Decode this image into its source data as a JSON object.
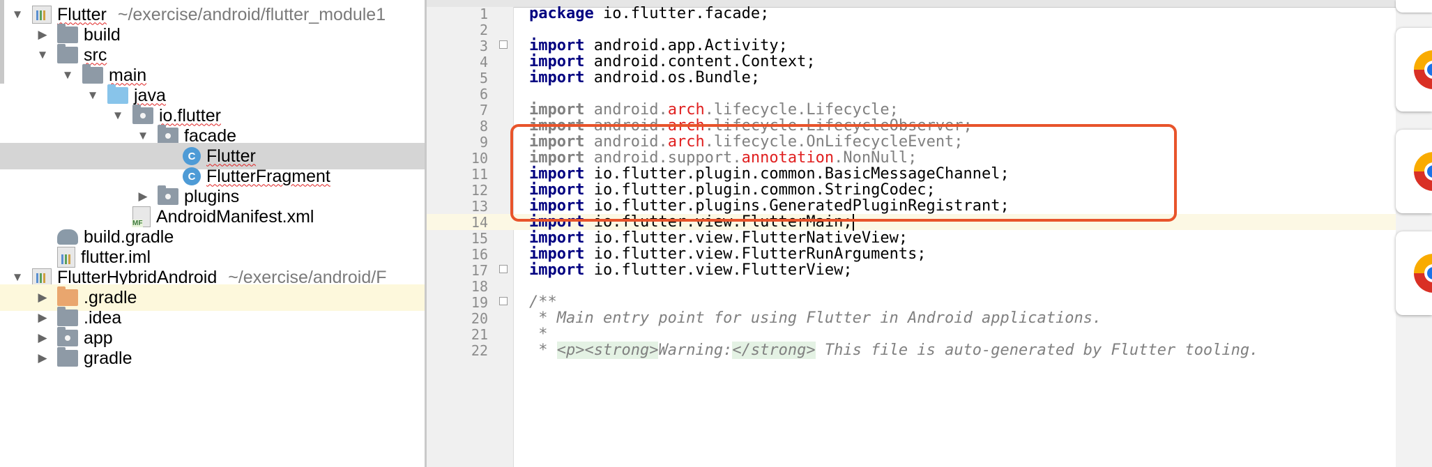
{
  "project_tree": {
    "rows": [
      {
        "label": "Flutter",
        "path": "~/exercise/android/flutter_module1",
        "arrow": "▼",
        "icon": "module-icon"
      },
      {
        "label": "build",
        "arrow": "▶",
        "icon": "folder-icon"
      },
      {
        "label": "src",
        "arrow": "▼",
        "icon": "folder-icon"
      },
      {
        "label": "main",
        "arrow": "▼",
        "icon": "folder-icon"
      },
      {
        "label": "java",
        "arrow": "▼",
        "icon": "source-folder-icon"
      },
      {
        "label": "io.flutter",
        "arrow": "▼",
        "icon": "package-icon"
      },
      {
        "label": "facade",
        "arrow": "▼",
        "icon": "package-icon"
      },
      {
        "label": "Flutter",
        "arrow": "",
        "icon": "class-icon",
        "icon_letter": "C"
      },
      {
        "label": "FlutterFragment",
        "arrow": "",
        "icon": "class-icon",
        "icon_letter": "C"
      },
      {
        "label": "plugins",
        "arrow": "▶",
        "icon": "package-icon"
      },
      {
        "label": "AndroidManifest.xml",
        "arrow": "",
        "icon": "manifest-icon",
        "icon_tag": "MF"
      },
      {
        "label": "build.gradle",
        "arrow": "",
        "icon": "gradle-icon"
      },
      {
        "label": "flutter.iml",
        "arrow": "",
        "icon": "iml-icon"
      },
      {
        "label": "FlutterHybridAndroid",
        "path": "~/exercise/android/F",
        "arrow": "▼",
        "icon": "module-icon"
      },
      {
        "label": ".gradle",
        "arrow": "▶",
        "icon": "excluded-folder-icon"
      },
      {
        "label": ".idea",
        "arrow": "▶",
        "icon": "folder-icon"
      },
      {
        "label": "app",
        "arrow": "▶",
        "icon": "module-folder-icon"
      },
      {
        "label": "gradle",
        "arrow": "▶",
        "icon": "folder-icon"
      }
    ]
  },
  "editor": {
    "lines": [
      {
        "n": "1",
        "parts": [
          [
            "kw",
            "package"
          ],
          [
            "p",
            " io.flutter.facade;"
          ]
        ]
      },
      {
        "n": "2",
        "parts": []
      },
      {
        "n": "3",
        "parts": [
          [
            "kw",
            "import"
          ],
          [
            "p",
            " android.app.Activity;"
          ]
        ]
      },
      {
        "n": "4",
        "parts": [
          [
            "kw",
            "import"
          ],
          [
            "p",
            " android.content.Context;"
          ]
        ]
      },
      {
        "n": "5",
        "parts": [
          [
            "kw",
            "import"
          ],
          [
            "p",
            " android.os.Bundle;"
          ]
        ]
      },
      {
        "n": "6",
        "parts": []
      },
      {
        "n": "7",
        "parts": [
          [
            "kw",
            "import"
          ],
          [
            "p",
            " android."
          ],
          [
            "err",
            "arch"
          ],
          [
            "p",
            ".lifecycle.Lifecycle;"
          ]
        ]
      },
      {
        "n": "8",
        "parts": [
          [
            "kw",
            "import"
          ],
          [
            "p",
            " android."
          ],
          [
            "err",
            "arch"
          ],
          [
            "p",
            ".lifecycle.LifecycleObserver;"
          ]
        ]
      },
      {
        "n": "9",
        "parts": [
          [
            "kw",
            "import"
          ],
          [
            "p",
            " android."
          ],
          [
            "err",
            "arch"
          ],
          [
            "p",
            ".lifecycle.OnLifecycleEvent;"
          ]
        ]
      },
      {
        "n": "10",
        "parts": [
          [
            "kw",
            "import"
          ],
          [
            "p",
            " android.support."
          ],
          [
            "err",
            "annotation"
          ],
          [
            "p",
            ".NonNull;"
          ]
        ]
      },
      {
        "n": "11",
        "parts": [
          [
            "kw",
            "import"
          ],
          [
            "p",
            " io.flutter.plugin.common.BasicMessageChannel;"
          ]
        ]
      },
      {
        "n": "12",
        "parts": [
          [
            "kw",
            "import"
          ],
          [
            "p",
            " io.flutter.plugin.common.StringCodec;"
          ]
        ]
      },
      {
        "n": "13",
        "parts": [
          [
            "kw",
            "import"
          ],
          [
            "p",
            " io.flutter.plugins.GeneratedPluginRegistrant;"
          ]
        ]
      },
      {
        "n": "14",
        "parts": [
          [
            "kw",
            "import"
          ],
          [
            "p",
            " io.flutter.view.FlutterMain;"
          ]
        ]
      },
      {
        "n": "15",
        "parts": [
          [
            "kw",
            "import"
          ],
          [
            "p",
            " io.flutter.view.FlutterNativeView;"
          ]
        ]
      },
      {
        "n": "16",
        "parts": [
          [
            "kw",
            "import"
          ],
          [
            "p",
            " io.flutter.view.FlutterRunArguments;"
          ]
        ]
      },
      {
        "n": "17",
        "parts": [
          [
            "kw",
            "import"
          ],
          [
            "p",
            " io.flutter.view.FlutterView;"
          ]
        ]
      },
      {
        "n": "18",
        "parts": []
      },
      {
        "n": "19",
        "parts": [
          [
            "comment",
            "/**"
          ]
        ]
      },
      {
        "n": "20",
        "parts": [
          [
            "comment",
            " * Main entry point for using Flutter in Android applications."
          ]
        ]
      },
      {
        "n": "21",
        "parts": [
          [
            "comment",
            " *"
          ]
        ]
      },
      {
        "n": "22",
        "parts": [
          [
            "comment",
            " * "
          ],
          [
            "tag",
            "<p><strong>"
          ],
          [
            "comment",
            "Warning:"
          ],
          [
            "tag",
            "</strong>"
          ],
          [
            "comment",
            " This file is auto-generated by Flutter tooling."
          ]
        ]
      }
    ]
  },
  "right_panel": {
    "cards": [
      {
        "icon": "chrome-icon"
      },
      {
        "icon": "chrome-icon"
      },
      {
        "icon": "chrome-icon"
      }
    ]
  },
  "colors": {
    "highlight_box": "#e8542b",
    "keyword": "#000080",
    "unresolved": "#e02020",
    "selection": "#d5d5d5"
  }
}
